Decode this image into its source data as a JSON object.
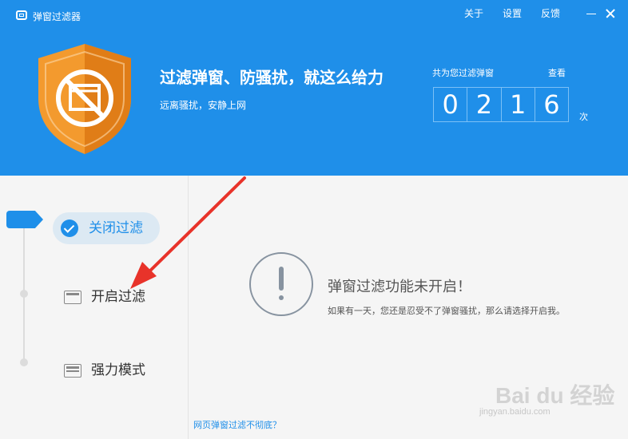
{
  "app": {
    "title": "弹窗过滤器"
  },
  "titlebar": {
    "menu": [
      "关于",
      "设置",
      "反馈"
    ]
  },
  "header": {
    "slogan": "过滤弹窗、防骚扰，就这么给力",
    "subslogan": "远离骚扰，安静上网",
    "count_label": "共为您过滤弹窗",
    "view_link": "查看",
    "counter_digits": [
      "0",
      "2",
      "1",
      "6"
    ],
    "unit": "次"
  },
  "sidebar": {
    "items": [
      {
        "label": "关闭过滤",
        "active": true
      },
      {
        "label": "开启过滤",
        "active": false
      },
      {
        "label": "强力模式",
        "active": false
      }
    ],
    "help_link": "网页弹窗过滤不彻底？"
  },
  "status": {
    "title": "弹窗过滤功能未开启！",
    "description": "如果有一天，您还是忍受不了弹窗骚扰，那么请选择开启我。"
  },
  "watermark": {
    "brand": "Bai du 经验",
    "url": "jingyan.baidu.com"
  },
  "colors": {
    "brand_blue": "#1f8fe9",
    "shield_orange": "#f39a2e",
    "annotation_red": "#e8332a"
  }
}
